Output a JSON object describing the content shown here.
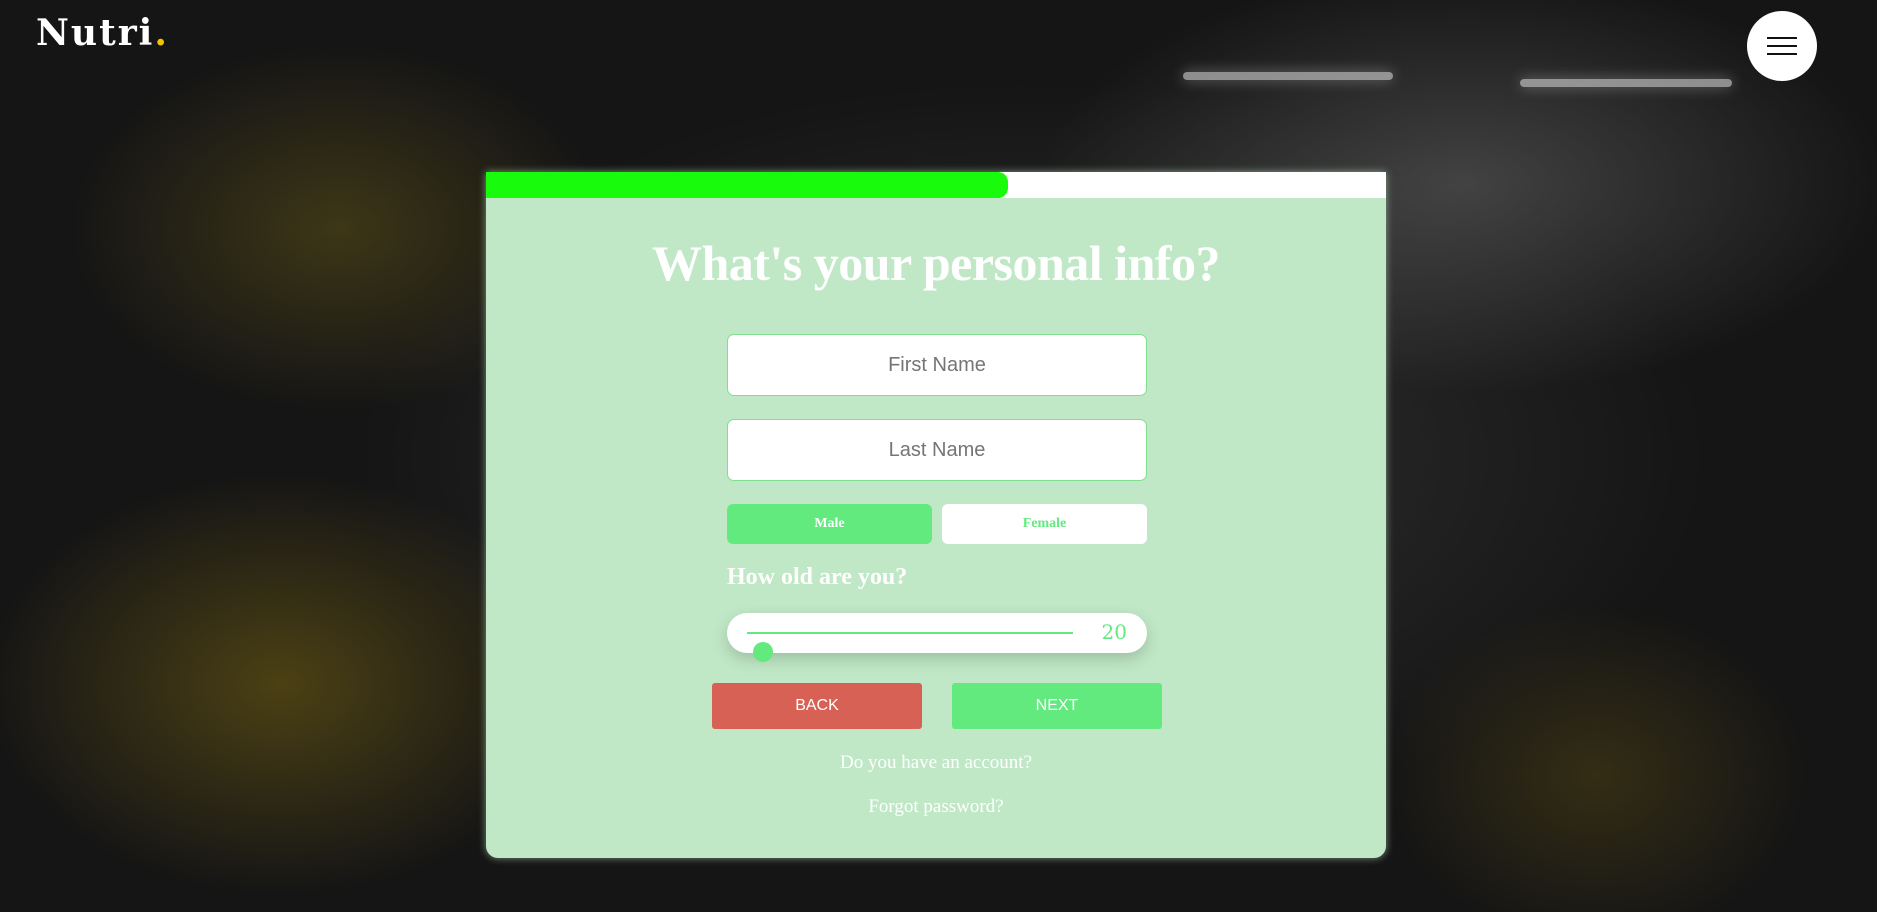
{
  "header": {
    "logo_text": "Nutri",
    "logo_dot": ".",
    "logo_dot_color": "#f2c200",
    "menu_icon": "hamburger-icon"
  },
  "progress": {
    "value_percent": 58,
    "color": "#19fb0d"
  },
  "form": {
    "title": "What's your personal info?",
    "first_name_placeholder": "First Name",
    "last_name_placeholder": "Last Name",
    "gender": {
      "male_label": "Male",
      "female_label": "Female",
      "selected": "Male"
    },
    "age_question": "How old are you?",
    "age": {
      "value": 20,
      "display": "20",
      "min": 16,
      "max": 100
    },
    "back_label": "BACK",
    "next_label": "NEXT",
    "account_link": "Do you have an account?",
    "forgot_link": "Forgot password?"
  },
  "colors": {
    "card_bg": "#c0e8c6",
    "accent_green": "#62ea7f",
    "back_red": "#d86155"
  }
}
